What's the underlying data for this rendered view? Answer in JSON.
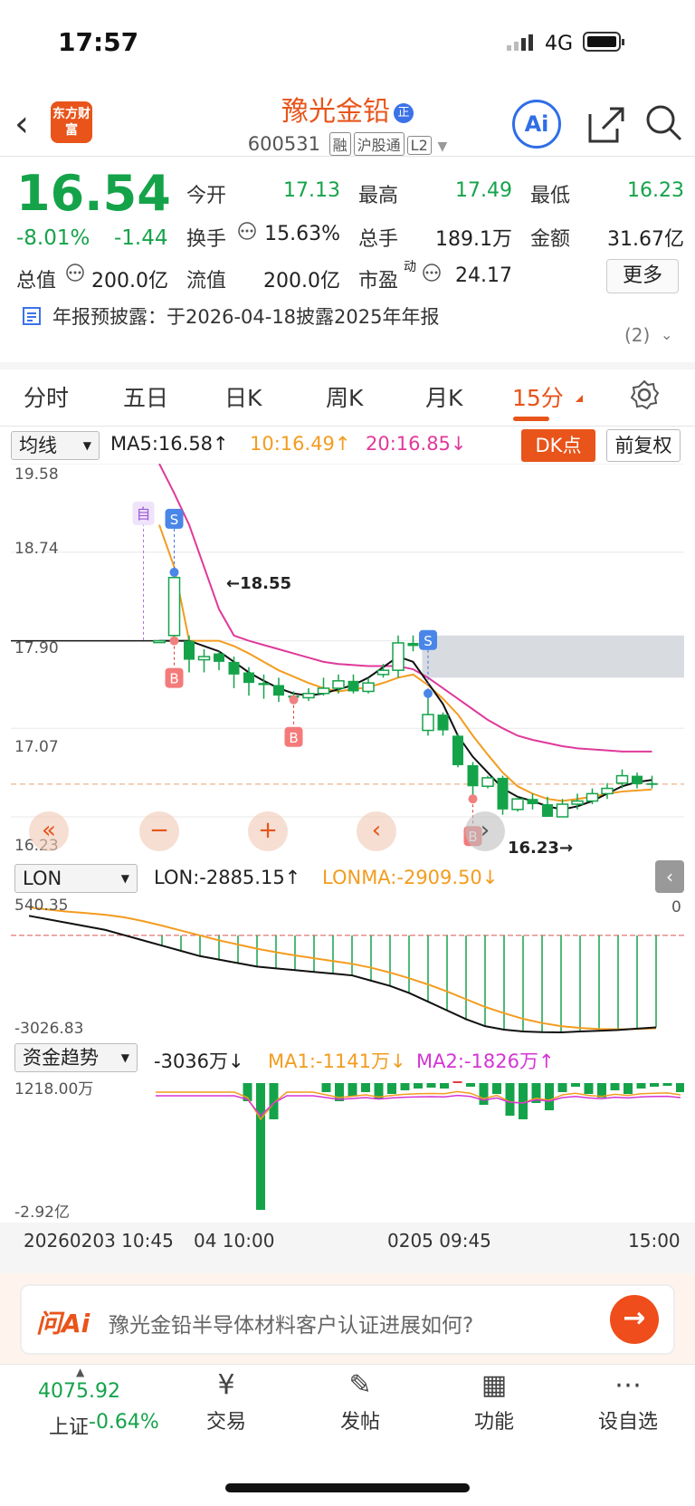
{
  "status": {
    "time": "17:57",
    "network": "4G"
  },
  "header": {
    "logo_text": "东方财富",
    "stock_name": "豫光金铅",
    "name_badge": "正",
    "code": "600531",
    "tags": [
      "融",
      "沪股通",
      "L2"
    ],
    "ai_label": "Ai"
  },
  "quote": {
    "price": "16.54",
    "change_pct": "-8.01%",
    "change_amt": "-1.44",
    "fields": [
      {
        "label": "今开",
        "value": "17.13",
        "color": "green"
      },
      {
        "label": "最高",
        "value": "17.49",
        "color": "green"
      },
      {
        "label": "最低",
        "value": "16.23",
        "color": "green"
      },
      {
        "label": "换手",
        "value": "15.63%",
        "color": "dark"
      },
      {
        "label": "总手",
        "value": "189.1万",
        "color": "dark"
      },
      {
        "label": "金额",
        "value": "31.67亿",
        "color": "dark"
      },
      {
        "label": "总值",
        "value": "200.0亿",
        "color": "dark"
      },
      {
        "label": "流值",
        "value": "200.0亿",
        "color": "dark"
      },
      {
        "label": "市盈",
        "value": "24.17",
        "color": "dark"
      }
    ],
    "pe_super": "动",
    "more_label": "更多"
  },
  "notice": {
    "text": "年报预披露：于2026-04-18披露2025年年报",
    "count": "(2)"
  },
  "tabs": [
    {
      "label": "分时"
    },
    {
      "label": "五日"
    },
    {
      "label": "日K"
    },
    {
      "label": "周K"
    },
    {
      "label": "月K"
    },
    {
      "label": "15分",
      "active": true
    }
  ],
  "indicator_bar": {
    "select": "均线",
    "ma5": "MA5:16.58↑",
    "ma10": "10:16.49↑",
    "ma20": "20:16.85↓",
    "dk_label": "DK点",
    "fq_label": "前复权"
  },
  "chart_data": {
    "type": "candlestick",
    "y_ticks": [
      "19.58",
      "18.74",
      "17.90",
      "17.07",
      "16.23"
    ],
    "ylim": [
      16.23,
      19.58
    ],
    "high_marker": "18.55",
    "low_marker": "16.23",
    "candles": [
      {
        "o": 17.9,
        "c": 17.9,
        "h": 17.9,
        "l": 17.9
      },
      {
        "o": 17.95,
        "c": 18.5,
        "h": 18.55,
        "l": 17.9
      },
      {
        "o": 17.9,
        "c": 17.72,
        "h": 17.95,
        "l": 17.6
      },
      {
        "o": 17.72,
        "c": 17.75,
        "h": 17.82,
        "l": 17.6
      },
      {
        "o": 17.78,
        "c": 17.7,
        "h": 17.8,
        "l": 17.62
      },
      {
        "o": 17.7,
        "c": 17.58,
        "h": 17.75,
        "l": 17.45
      },
      {
        "o": 17.6,
        "c": 17.5,
        "h": 17.65,
        "l": 17.38
      },
      {
        "o": 17.5,
        "c": 17.48,
        "h": 17.58,
        "l": 17.35
      },
      {
        "o": 17.48,
        "c": 17.38,
        "h": 17.55,
        "l": 17.32
      },
      {
        "o": 17.38,
        "c": 17.36,
        "h": 17.42,
        "l": 17.34
      },
      {
        "o": 17.36,
        "c": 17.4,
        "h": 17.45,
        "l": 17.33
      },
      {
        "o": 17.4,
        "c": 17.45,
        "h": 17.55,
        "l": 17.38
      },
      {
        "o": 17.45,
        "c": 17.52,
        "h": 17.58,
        "l": 17.4
      },
      {
        "o": 17.52,
        "c": 17.42,
        "h": 17.58,
        "l": 17.4
      },
      {
        "o": 17.42,
        "c": 17.5,
        "h": 17.55,
        "l": 17.4
      },
      {
        "o": 17.58,
        "c": 17.62,
        "h": 17.68,
        "l": 17.55
      },
      {
        "o": 17.62,
        "c": 17.88,
        "h": 17.95,
        "l": 17.55
      },
      {
        "o": 17.88,
        "c": 17.85,
        "h": 17.95,
        "l": 17.8
      },
      {
        "o": 17.05,
        "c": 17.2,
        "h": 17.4,
        "l": 17.0
      },
      {
        "o": 17.2,
        "c": 17.05,
        "h": 17.22,
        "l": 17.0
      },
      {
        "o": 17.0,
        "c": 16.72,
        "h": 17.02,
        "l": 16.7
      },
      {
        "o": 16.72,
        "c": 16.52,
        "h": 16.75,
        "l": 16.4
      },
      {
        "o": 16.52,
        "c": 16.6,
        "h": 16.62,
        "l": 16.5
      },
      {
        "o": 16.6,
        "c": 16.3,
        "h": 16.62,
        "l": 16.25
      },
      {
        "o": 16.3,
        "c": 16.4,
        "h": 16.42,
        "l": 16.28
      },
      {
        "o": 16.4,
        "c": 16.35,
        "h": 16.45,
        "l": 16.3
      },
      {
        "o": 16.35,
        "c": 16.23,
        "h": 16.42,
        "l": 16.23
      },
      {
        "o": 16.23,
        "c": 16.35,
        "h": 16.4,
        "l": 16.23
      },
      {
        "o": 16.35,
        "c": 16.38,
        "h": 16.45,
        "l": 16.3
      },
      {
        "o": 16.38,
        "c": 16.45,
        "h": 16.5,
        "l": 16.35
      },
      {
        "o": 16.45,
        "c": 16.5,
        "h": 16.55,
        "l": 16.4
      },
      {
        "o": 16.55,
        "c": 16.62,
        "h": 16.68,
        "l": 16.5
      },
      {
        "o": 16.62,
        "c": 16.54,
        "h": 16.65,
        "l": 16.5
      },
      {
        "o": 16.55,
        "c": 16.54,
        "h": 16.62,
        "l": 16.5
      }
    ],
    "ma5": [
      17.9,
      17.9,
      17.9,
      17.85,
      17.8,
      17.7,
      17.6,
      17.52,
      17.45,
      17.4,
      17.38,
      17.4,
      17.44,
      17.48,
      17.55,
      17.65,
      17.75,
      17.7,
      17.5,
      17.3,
      17.0,
      16.8,
      16.65,
      16.5,
      16.42,
      16.38,
      16.33,
      16.3,
      16.33,
      16.38,
      16.45,
      16.52,
      16.56,
      16.58
    ],
    "ma10": [
      19.0,
      18.6,
      17.9,
      17.9,
      17.9,
      17.85,
      17.78,
      17.7,
      17.62,
      17.56,
      17.5,
      17.45,
      17.42,
      17.44,
      17.46,
      17.5,
      17.55,
      17.58,
      17.48,
      17.35,
      17.2,
      17.0,
      16.82,
      16.65,
      16.52,
      16.45,
      16.4,
      16.38,
      16.4,
      16.42,
      16.45,
      16.47,
      16.48,
      16.49
    ],
    "ma20": [
      19.58,
      19.3,
      19.0,
      18.6,
      18.2,
      17.95,
      17.9,
      17.86,
      17.82,
      17.78,
      17.74,
      17.7,
      17.68,
      17.67,
      17.66,
      17.66,
      17.66,
      17.63,
      17.55,
      17.45,
      17.35,
      17.25,
      17.15,
      17.07,
      17.0,
      16.96,
      16.93,
      16.9,
      16.88,
      16.87,
      16.86,
      16.85,
      16.85,
      16.85
    ],
    "signals": [
      {
        "type": "自",
        "idx": 1
      },
      {
        "type": "S",
        "idx": 1
      },
      {
        "type": "B",
        "idx": 1
      },
      {
        "type": "B",
        "idx": 9
      },
      {
        "type": "S",
        "idx": 18
      },
      {
        "type": "B",
        "idx": 21
      }
    ],
    "lon": {
      "select": "LON",
      "lon_text": "LON:-2885.15↑",
      "lonma_text": "LONMA:-2909.50↓",
      "y_top": "540.35",
      "y_bottom": "-3026.83",
      "right_zero": "0"
    },
    "fund": {
      "select": "资金趋势",
      "value_text": "-3036万↓",
      "ma1_text": "MA1:-1141万↓",
      "ma2_text": "MA2:-1826万↑",
      "y_top": "1218.00万",
      "y_bottom": "-2.92亿"
    },
    "x_labels": [
      "20260203 10:45",
      "04 10:00",
      "0205 09:45",
      "15:00"
    ]
  },
  "ask": {
    "logo": "问Ai",
    "text": "豫光金铅半导体材料客户认证进展如何?"
  },
  "bottom_nav": {
    "index_value": "4075.92",
    "index_name": "上证",
    "index_change": "-0.64%",
    "items": [
      {
        "label": "交易",
        "icon": "yen-icon"
      },
      {
        "label": "发帖",
        "icon": "edit-icon"
      },
      {
        "label": "功能",
        "icon": "grid-icon"
      },
      {
        "label": "设自选",
        "icon": "more-icon"
      }
    ]
  },
  "colors": {
    "accent": "#e8541a",
    "down": "#15a34a",
    "up": "#e23b3b",
    "ma5": "#111111",
    "ma10": "#f39c1f",
    "ma20": "#e0399a"
  }
}
